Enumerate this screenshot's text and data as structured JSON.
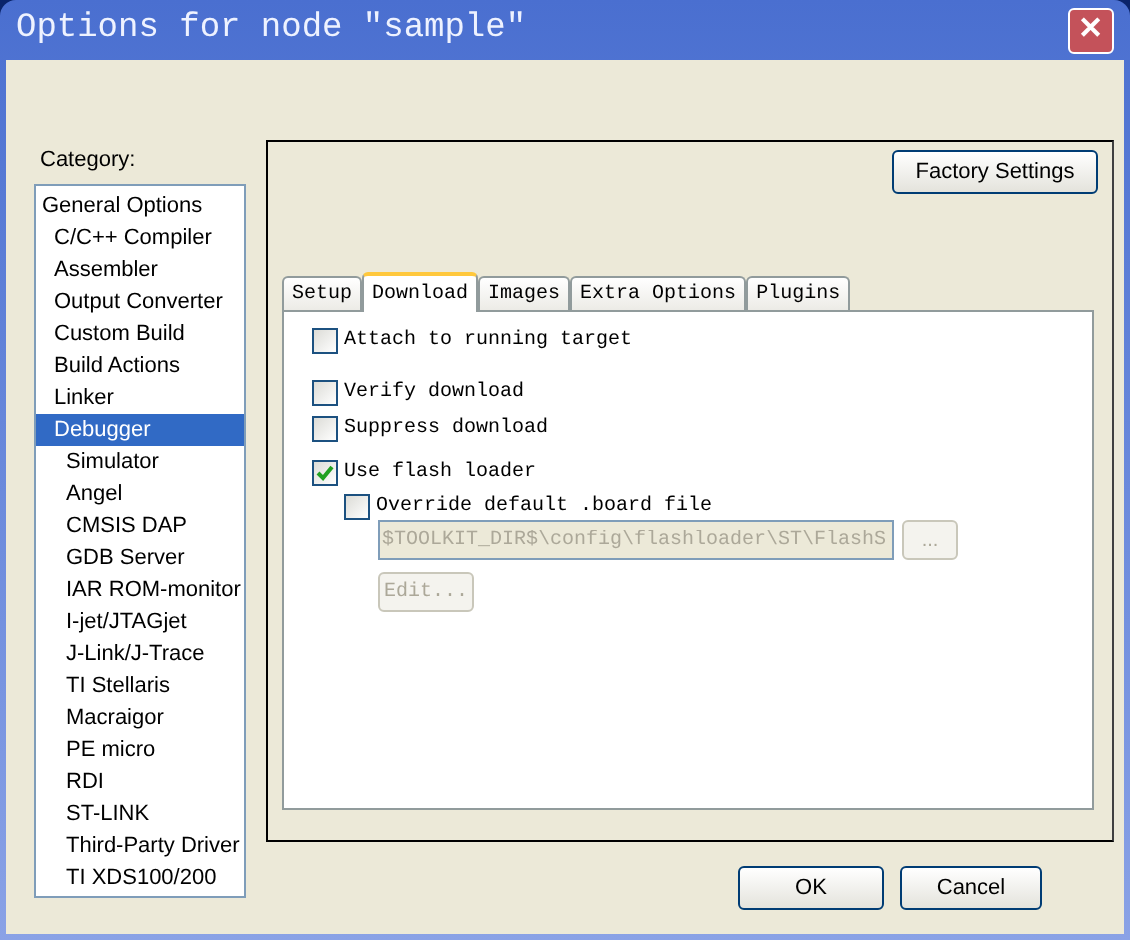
{
  "window": {
    "title": "Options for node \"sample\"",
    "close_symbol": "✕"
  },
  "category": {
    "label": "Category:",
    "items": [
      {
        "label": "General Options",
        "selected": false,
        "children": [
          {
            "label": "C/C++ Compiler",
            "selected": false
          },
          {
            "label": "Assembler",
            "selected": false
          },
          {
            "label": "Output Converter",
            "selected": false
          },
          {
            "label": "Custom Build",
            "selected": false
          },
          {
            "label": "Build Actions",
            "selected": false
          },
          {
            "label": "Linker",
            "selected": false
          },
          {
            "label": "Debugger",
            "selected": true,
            "children": [
              {
                "label": "Simulator",
                "selected": false
              },
              {
                "label": "Angel",
                "selected": false
              },
              {
                "label": "CMSIS DAP",
                "selected": false
              },
              {
                "label": "GDB Server",
                "selected": false
              },
              {
                "label": "IAR ROM-monitor",
                "selected": false
              },
              {
                "label": "I-jet/JTAGjet",
                "selected": false
              },
              {
                "label": "J-Link/J-Trace",
                "selected": false
              },
              {
                "label": "TI Stellaris",
                "selected": false
              },
              {
                "label": "Macraigor",
                "selected": false
              },
              {
                "label": "PE micro",
                "selected": false
              },
              {
                "label": "RDI",
                "selected": false
              },
              {
                "label": "ST-LINK",
                "selected": false
              },
              {
                "label": "Third-Party Driver",
                "selected": false
              },
              {
                "label": "TI XDS100/200",
                "selected": false
              }
            ]
          }
        ]
      }
    ]
  },
  "factory_settings_button": "Factory Settings",
  "tabs": [
    {
      "label": "Setup",
      "selected": false
    },
    {
      "label": "Download",
      "selected": true
    },
    {
      "label": "Images",
      "selected": false
    },
    {
      "label": "Extra Options",
      "selected": false
    },
    {
      "label": "Plugins",
      "selected": false
    }
  ],
  "options": [
    {
      "kind": "checkbox",
      "label": "Attach to running target",
      "checked": false
    },
    {
      "kind": "checkbox",
      "label": "Verify download",
      "checked": false
    },
    {
      "kind": "checkbox",
      "label": "Suppress download",
      "checked": false
    },
    {
      "kind": "checkbox",
      "label": "Use flash loader",
      "checked": true,
      "children": [
        {
          "kind": "checkbox",
          "label": "Override default .board file",
          "checked": false
        },
        {
          "kind": "path",
          "value": "$TOOLKIT_DIR$\\config\\flashloader\\ST\\FlashS",
          "browse": "...",
          "disabled": true
        },
        {
          "kind": "button",
          "label": "Edit...",
          "disabled": true
        }
      ]
    }
  ],
  "buttons": [
    "OK",
    "Cancel"
  ]
}
